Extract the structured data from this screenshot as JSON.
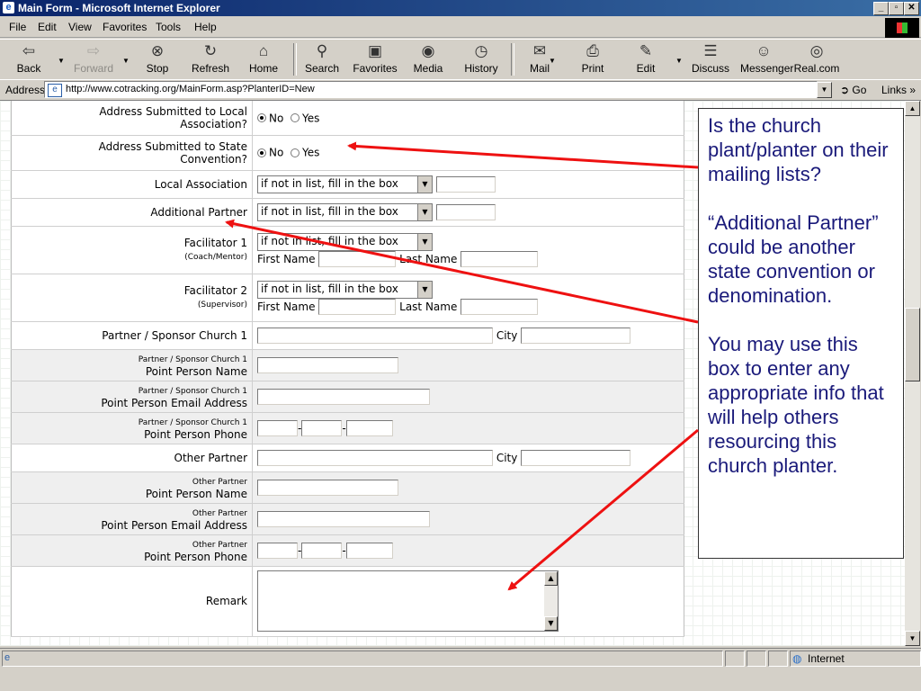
{
  "window": {
    "title": "Main Form - Microsoft Internet Explorer",
    "controls": {
      "minimize": "_",
      "maximize": "▫",
      "close": "✕"
    }
  },
  "menu": [
    "File",
    "Edit",
    "View",
    "Favorites",
    "Tools",
    "Help"
  ],
  "toolbar": [
    {
      "label": "Back",
      "icon": "back-arrow-icon"
    },
    {
      "label": "Forward",
      "icon": "forward-arrow-icon",
      "disabled": true
    },
    {
      "label": "Stop",
      "icon": "stop-icon"
    },
    {
      "label": "Refresh",
      "icon": "refresh-icon"
    },
    {
      "label": "Home",
      "icon": "home-icon"
    },
    {
      "label": "Search",
      "icon": "search-icon"
    },
    {
      "label": "Favorites",
      "icon": "favorites-icon"
    },
    {
      "label": "Media",
      "icon": "media-icon"
    },
    {
      "label": "History",
      "icon": "history-icon"
    },
    {
      "label": "Mail",
      "icon": "mail-icon"
    },
    {
      "label": "Print",
      "icon": "print-icon"
    },
    {
      "label": "Edit",
      "icon": "edit-icon"
    },
    {
      "label": "Discuss",
      "icon": "discuss-icon"
    },
    {
      "label": "Messenger",
      "icon": "messenger-icon"
    },
    {
      "label": "Real.com",
      "icon": "realcom-icon"
    }
  ],
  "address": {
    "label": "Address",
    "url": "http://www.cotracking.org/MainForm.asp?PlanterID=New",
    "go": "Go",
    "links": "Links"
  },
  "form": {
    "radio_yes": "Yes",
    "radio_no": "No",
    "select_default": "if not in list, fill in the box",
    "first_name": "First Name",
    "last_name": "Last Name",
    "city": "City",
    "rows": {
      "addr_local_line1": "Address Submitted to Local",
      "addr_local_line2": "Association?",
      "addr_state_line1": "Address Submitted to State",
      "addr_state_line2": "Convention?",
      "local_association": "Local Association",
      "additional_partner": "Additional Partner",
      "facilitator1": "Facilitator 1",
      "facilitator1_sub": "(Coach/Mentor)",
      "facilitator2": "Facilitator 2",
      "facilitator2_sub": "(Supervisor)",
      "partner_church1": "Partner / Sponsor Church 1",
      "pc1_name_small": "Partner / Sponsor Church 1",
      "pc1_name": "Point Person Name",
      "pc1_email_small": "Partner / Sponsor Church 1",
      "pc1_email": "Point Person Email Address",
      "pc1_phone_small": "Partner / Sponsor Church 1",
      "pc1_phone": "Point Person Phone",
      "other_partner": "Other Partner",
      "op_name_small": "Other Partner",
      "op_name": "Point Person Name",
      "op_email_small": "Other Partner",
      "op_email": "Point Person Email Address",
      "op_phone_small": "Other Partner",
      "op_phone": "Point Person Phone",
      "remark": "Remark"
    },
    "phone_sep": "-"
  },
  "callout": {
    "p1": "Is the church plant/planter on their mailing lists?",
    "p2": "“Additional Partner” could be another state convention or denomination.",
    "p3": "You may use this box to enter any appropriate info that will help others resourcing this church planter."
  },
  "status": {
    "zone": "Internet"
  },
  "colors": {
    "arrow": "#ee1111",
    "callout_text": "#1a1a7a",
    "titlebar": "#0a246a"
  }
}
